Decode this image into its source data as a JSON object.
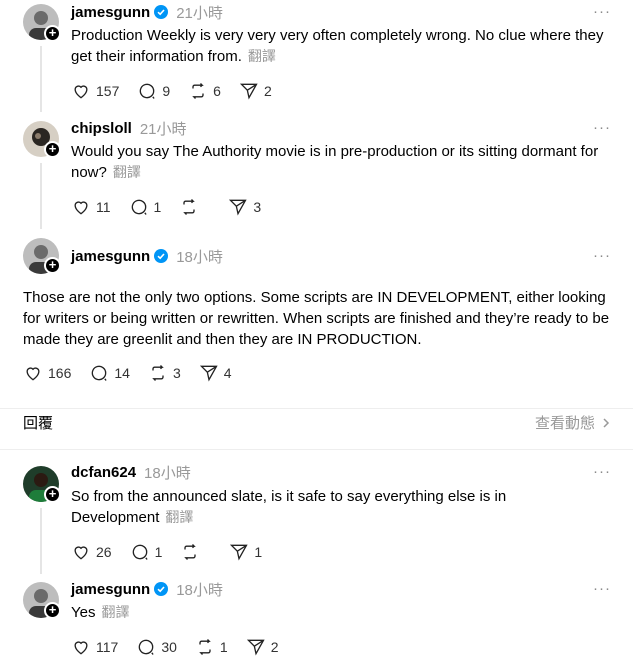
{
  "posts": [
    {
      "username": "jamesgunn",
      "verified": true,
      "time": "21小時",
      "text": "Production Weekly is very very very often completely wrong. No clue where they get their information from.",
      "translate": "翻譯",
      "likes": "157",
      "comments": "9",
      "reposts": "6",
      "shares": "2"
    },
    {
      "username": "chipsloll",
      "verified": false,
      "time": "21小時",
      "text": "Would you say The Authority movie is in pre-production or its sitting dormant for now?",
      "translate": "翻譯",
      "likes": "11",
      "comments": "1",
      "reposts": "",
      "shares": "3"
    },
    {
      "username": "jamesgunn",
      "verified": true,
      "time": "18小時",
      "text": "Those are not the only two options. Some scripts are IN DEVELOPMENT, either looking for writers or being written or rewritten. When scripts are finished and they’re ready to be made they are greenlit and then they are IN PRODUCTION.",
      "likes": "166",
      "comments": "14",
      "reposts": "3",
      "shares": "4"
    },
    {
      "username": "dcfan624",
      "verified": false,
      "time": "18小時",
      "text": "So from the announced slate, is it safe to say everything else is in Development",
      "translate": "翻譯",
      "likes": "26",
      "comments": "1",
      "reposts": "",
      "shares": "1"
    },
    {
      "username": "jamesgunn",
      "verified": true,
      "time": "18小時",
      "text": "Yes",
      "translate": "翻譯",
      "likes": "117",
      "comments": "30",
      "reposts": "1",
      "shares": "2"
    }
  ],
  "replies_header": {
    "label": "回覆",
    "activity_link": "查看動態",
    "chevron": "chevron-right-icon"
  },
  "more_glyph": "···",
  "colors": {
    "verified": "#0095f6",
    "muted": "#999999",
    "divider": "#eeeeee"
  }
}
